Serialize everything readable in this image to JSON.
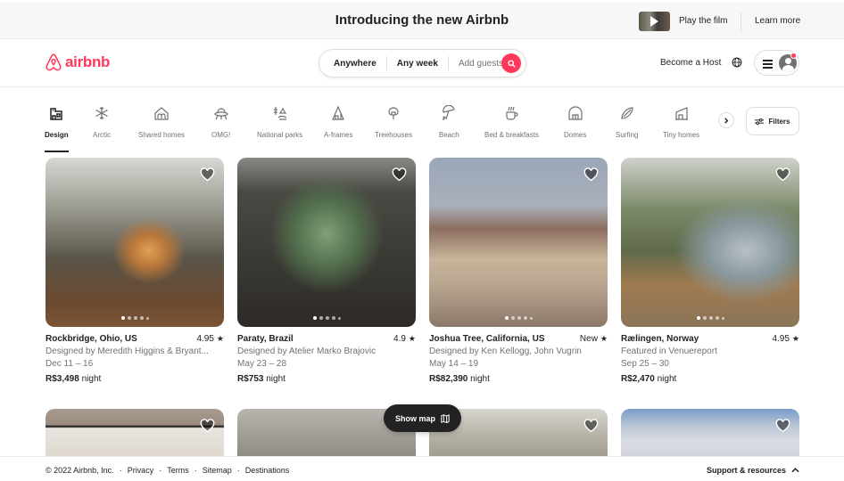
{
  "announcement": {
    "title": "Introducing the new Airbnb",
    "play_film": "Play the film",
    "learn_more": "Learn more"
  },
  "header": {
    "logo_text": "airbnb",
    "search": {
      "location": "Anywhere",
      "dates": "Any week",
      "guests_placeholder": "Add guests"
    },
    "become_host": "Become a Host"
  },
  "categories": [
    {
      "label": "Design",
      "icon": "design-icon",
      "active": true
    },
    {
      "label": "Arctic",
      "icon": "snowflake-icon"
    },
    {
      "label": "Shared homes",
      "icon": "shared-home-icon"
    },
    {
      "label": "OMG!",
      "icon": "ufo-icon"
    },
    {
      "label": "National parks",
      "icon": "national-park-icon"
    },
    {
      "label": "A-frames",
      "icon": "a-frame-icon"
    },
    {
      "label": "Treehouses",
      "icon": "treehouse-icon"
    },
    {
      "label": "Beach",
      "icon": "beach-umbrella-icon"
    },
    {
      "label": "Bed & breakfasts",
      "icon": "coffee-cup-icon"
    },
    {
      "label": "Domes",
      "icon": "dome-icon"
    },
    {
      "label": "Surfing",
      "icon": "surfboard-icon"
    },
    {
      "label": "Tiny homes",
      "icon": "tiny-home-icon"
    }
  ],
  "filters_label": "Filters",
  "listings": [
    {
      "location": "Rockbridge, Ohio, US",
      "rating": "4.95",
      "subtitle": "Designed by Meredith Higgins & Bryant...",
      "dates": "Dec 11 – 16",
      "price": "R$3,498",
      "price_unit": "night"
    },
    {
      "location": "Paraty, Brazil",
      "rating": "4.9",
      "subtitle": "Designed by Atelier Marko Brajovic",
      "dates": "May 23 – 28",
      "price": "R$753",
      "price_unit": "night"
    },
    {
      "location": "Joshua Tree, California, US",
      "rating": "New",
      "subtitle": "Designed by Ken Kellogg, John Vugrin",
      "dates": "May 14 – 19",
      "price": "R$82,390",
      "price_unit": "night"
    },
    {
      "location": "Rælingen, Norway",
      "rating": "4.95",
      "subtitle": "Featured in Venuereport",
      "dates": "Sep 25 – 30",
      "price": "R$2,470",
      "price_unit": "night"
    }
  ],
  "show_map": "Show map",
  "footer": {
    "copyright": "© 2022 Airbnb, Inc.",
    "links": [
      "Privacy",
      "Terms",
      "Sitemap",
      "Destinations"
    ],
    "support": "Support & resources"
  },
  "colors": {
    "brand": "#ff385c",
    "text": "#222222",
    "muted": "#717171"
  }
}
